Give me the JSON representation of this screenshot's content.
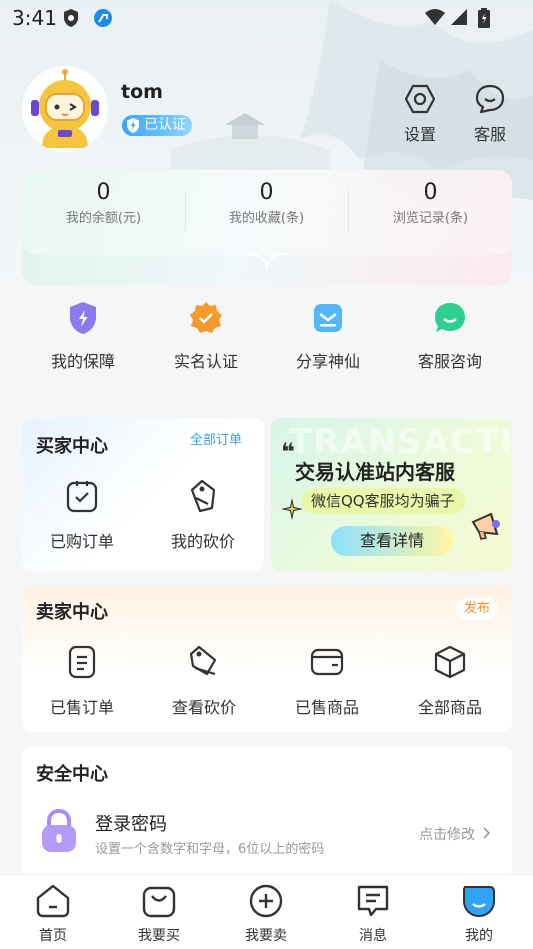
{
  "status_bar": {
    "time": "3:41"
  },
  "profile": {
    "username": "tom",
    "verified_label": "已认证"
  },
  "top_actions": [
    {
      "label": "设置",
      "icon": "settings-icon"
    },
    {
      "label": "客服",
      "icon": "customer-service-icon"
    }
  ],
  "stats": [
    {
      "value": "0",
      "label": "我的余额(元)"
    },
    {
      "value": "0",
      "label": "我的收藏(条)"
    },
    {
      "value": "0",
      "label": "浏览记录(条)"
    }
  ],
  "quick_actions": [
    {
      "label": "我的保障",
      "icon": "shield-icon"
    },
    {
      "label": "实名认证",
      "icon": "verified-badge-icon"
    },
    {
      "label": "分享神仙",
      "icon": "share-icon"
    },
    {
      "label": "客服咨询",
      "icon": "chat-icon"
    }
  ],
  "buyer": {
    "title": "买家中心",
    "all_orders": "全部订单",
    "items": [
      {
        "label": "已购订单",
        "icon": "order-icon"
      },
      {
        "label": "我的砍价",
        "icon": "price-tag-icon"
      }
    ]
  },
  "banner": {
    "title": "交易认准站内客服",
    "subtitle": "微信QQ客服均为骗子",
    "button": "查看详情",
    "watermark": "TRANSACTIO"
  },
  "seller": {
    "title": "卖家中心",
    "publish": "发布",
    "items": [
      {
        "label": "已售订单",
        "icon": "receipt-icon"
      },
      {
        "label": "查看砍价",
        "icon": "price-tag-icon"
      },
      {
        "label": "已售商品",
        "icon": "wallet-icon"
      },
      {
        "label": "全部商品",
        "icon": "box-icon"
      }
    ]
  },
  "security": {
    "title": "安全中心",
    "login_password": {
      "title": "登录密码",
      "desc": "设置一个含数字和字母，6位以上的密码",
      "action": "点击修改"
    }
  },
  "tabs": [
    {
      "label": "首页",
      "icon": "home-icon"
    },
    {
      "label": "我要买",
      "icon": "shopping-bag-icon"
    },
    {
      "label": "我要卖",
      "icon": "plus-circle-icon"
    },
    {
      "label": "消息",
      "icon": "message-icon"
    },
    {
      "label": "我的",
      "icon": "profile-icon",
      "active": true
    }
  ],
  "colors": {
    "accent": "#2fa3f5",
    "buyer_pill": "#2fa3f5",
    "seller_pill": "#f08a2c"
  }
}
